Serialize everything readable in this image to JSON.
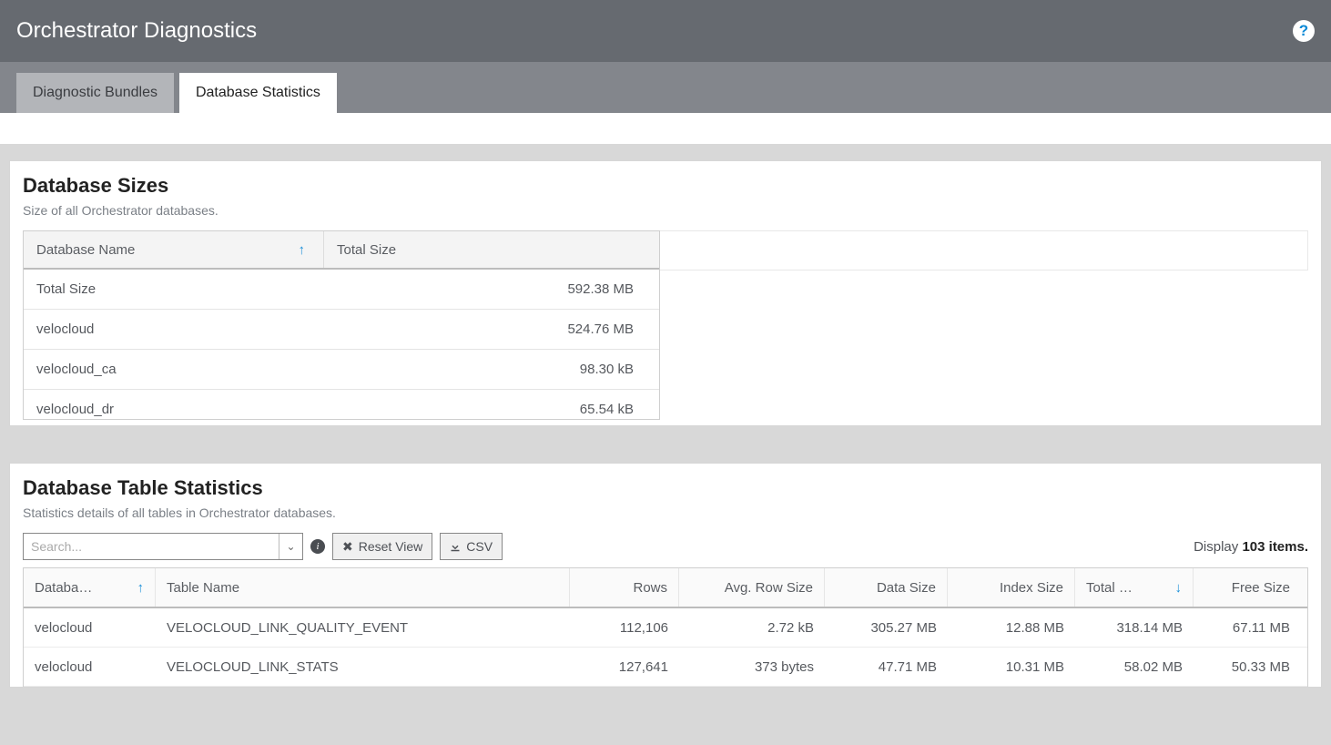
{
  "header": {
    "title": "Orchestrator Diagnostics",
    "help_icon_label": "?"
  },
  "tabs": [
    {
      "label": "Diagnostic Bundles",
      "active": false
    },
    {
      "label": "Database Statistics",
      "active": true
    }
  ],
  "sizes_panel": {
    "title": "Database Sizes",
    "subtitle": "Size of all Orchestrator databases.",
    "columns": {
      "name": "Database Name",
      "total": "Total Size"
    },
    "rows": [
      {
        "name": "Total Size",
        "size": "592.38 MB"
      },
      {
        "name": "velocloud",
        "size": "524.76 MB"
      },
      {
        "name": "velocloud_ca",
        "size": "98.30 kB"
      },
      {
        "name": "velocloud_dr",
        "size": "65.54 kB"
      }
    ]
  },
  "stats_panel": {
    "title": "Database Table Statistics",
    "subtitle": "Statistics details of all tables in Orchestrator databases.",
    "search_placeholder": "Search...",
    "reset_label": "Reset View",
    "csv_label": "CSV",
    "display_prefix": "Display ",
    "display_count": "103 items.",
    "columns": {
      "db": "Databa…",
      "tn": "Table Name",
      "rows": "Rows",
      "ars": "Avg. Row Size",
      "ds": "Data Size",
      "is": "Index Size",
      "ts": "Total …",
      "fs": "Free Size"
    },
    "rows": [
      {
        "db": "velocloud",
        "tn": "VELOCLOUD_LINK_QUALITY_EVENT",
        "rows": "112,106",
        "ars": "2.72 kB",
        "ds": "305.27 MB",
        "is": "12.88 MB",
        "ts": "318.14 MB",
        "fs": "67.11 MB"
      },
      {
        "db": "velocloud",
        "tn": "VELOCLOUD_LINK_STATS",
        "rows": "127,641",
        "ars": "373 bytes",
        "ds": "47.71 MB",
        "is": "10.31 MB",
        "ts": "58.02 MB",
        "fs": "50.33 MB"
      }
    ]
  }
}
